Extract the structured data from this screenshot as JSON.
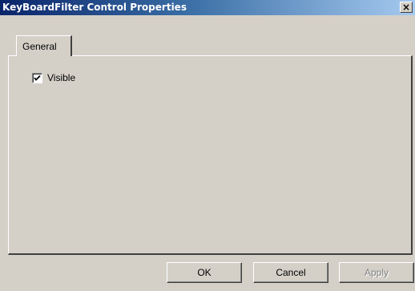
{
  "window": {
    "title": "KeyBoardFilter Control Properties",
    "close_glyph": "×"
  },
  "tabs": [
    {
      "label": "General",
      "selected": true
    }
  ],
  "general": {
    "visible_checkbox": {
      "label": "Visible",
      "checked": true
    }
  },
  "buttons": {
    "ok": "OK",
    "cancel": "Cancel",
    "apply": "Apply"
  },
  "colors": {
    "face": "#d4d0c8",
    "title_start": "#0a246a",
    "title_end": "#a6caf0",
    "disabled_text": "#808080"
  }
}
